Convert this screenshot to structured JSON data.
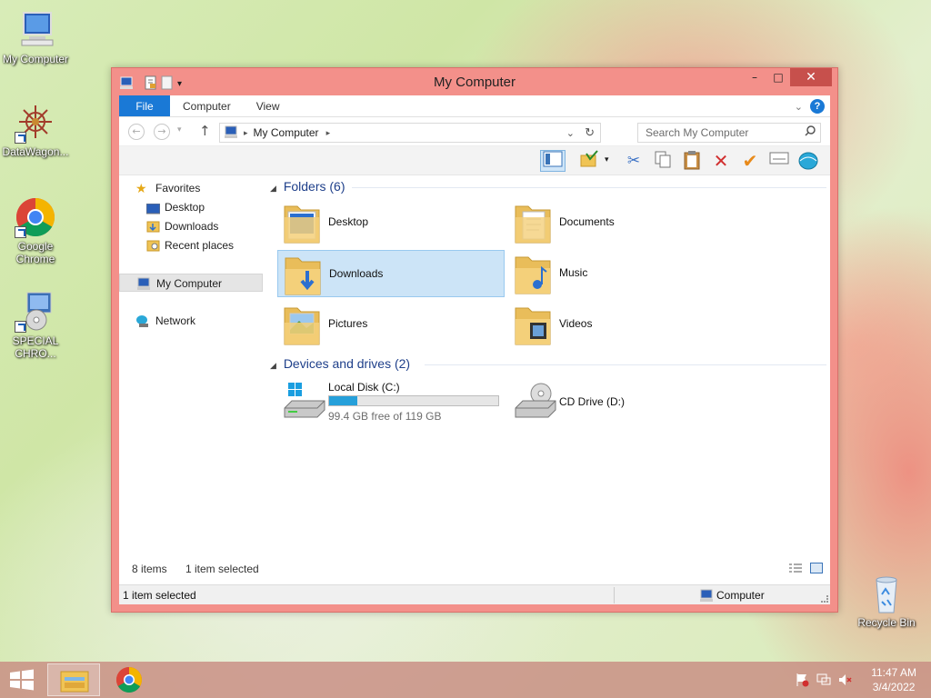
{
  "desktop": {
    "icons": [
      {
        "label_line1": "My Computer",
        "label_line2": ""
      },
      {
        "label_line1": "DataWagon...",
        "label_line2": ""
      },
      {
        "label_line1": "Google",
        "label_line2": "Chrome"
      },
      {
        "label_line1": "SPECIAL",
        "label_line2": "CHRO..."
      },
      {
        "label_line1": "Recycle Bin",
        "label_line2": ""
      }
    ]
  },
  "window": {
    "title": "My Computer",
    "controls": {
      "minimize": "–",
      "maximize": "□",
      "close": "✕"
    },
    "ribbon_tabs": [
      "File",
      "Computer",
      "View"
    ],
    "address": {
      "path": "My Computer"
    },
    "search": {
      "placeholder": "Search My Computer"
    },
    "nav": {
      "favorites": "Favorites",
      "favorites_items": [
        "Desktop",
        "Downloads",
        "Recent places"
      ],
      "this_pc": "My Computer",
      "network": "Network"
    },
    "groups": {
      "folders": "Folders (6)",
      "devices": "Devices and drives (2)"
    },
    "folders": [
      "Desktop",
      "Documents",
      "Downloads",
      "Music",
      "Pictures",
      "Videos"
    ],
    "drives": {
      "c": {
        "name": "Local Disk (C:)",
        "free_text": "99.4 GB free of 119 GB",
        "used_fraction": 0.165
      },
      "d": {
        "name": "CD Drive (D:)"
      }
    },
    "status": {
      "items": "8 items",
      "selected": "1 item selected",
      "bottom_selected": "1 item selected",
      "location": "Computer"
    }
  },
  "taskbar": {
    "time": "11:47 AM",
    "date": "3/4/2022"
  },
  "colors": {
    "window_frame": "#f3908a",
    "file_tab": "#1a79d6",
    "selection": "#cce4f7",
    "group_heading": "#1e3f8a",
    "progress": "#26a0da"
  }
}
